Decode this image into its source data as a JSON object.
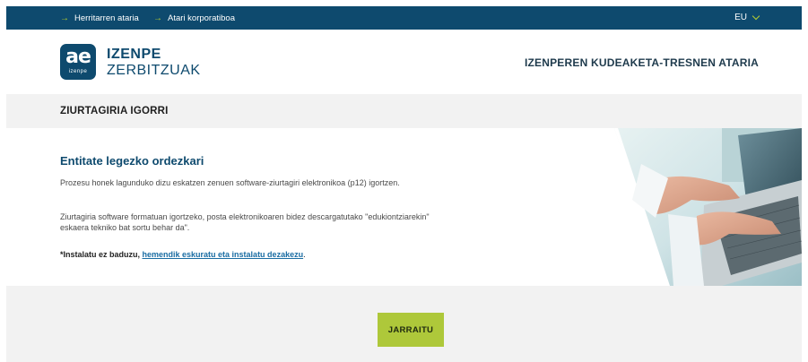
{
  "topbar": {
    "links": [
      "Herritarren ataria",
      "Atari korporatiboa"
    ],
    "language": "EU"
  },
  "header": {
    "logo_mark": "ae",
    "logo_sub": "izenpe",
    "brand_line1": "IZENPE",
    "brand_line2": "ZERBITZUAK",
    "portal_title": "IZENPEREN KUDEAKETA-TRESNEN ATARIA"
  },
  "section": {
    "title": "ZIURTAGIRIA IGORRI"
  },
  "content": {
    "title": "Entitate legezko ordezkari",
    "paragraph1": "Prozesu honek lagunduko dizu eskatzen zenuen software-ziurtagiri elektronikoa (p12) igortzen.",
    "paragraph2": "Ziurtagiria software formatuan igortzeko, posta elektronikoaren bidez descargatutako \"edukiontziarekin\" eskaera tekniko bat sortu behar da\".",
    "install_prefix": "*Instalatu ez baduzu, ",
    "install_link": "hemendik eskuratu eta instalatu dezakezu",
    "install_suffix": "."
  },
  "actions": {
    "continue_label": "JARRAITU"
  },
  "colors": {
    "navy": "#0e4a6e",
    "accent_green": "#aec83a",
    "band_gray": "#f2f2f2",
    "link_blue": "#1a6da3"
  },
  "icons": [
    "arrow-right-icon",
    "chevron-down-icon",
    "izenpe-logo"
  ]
}
